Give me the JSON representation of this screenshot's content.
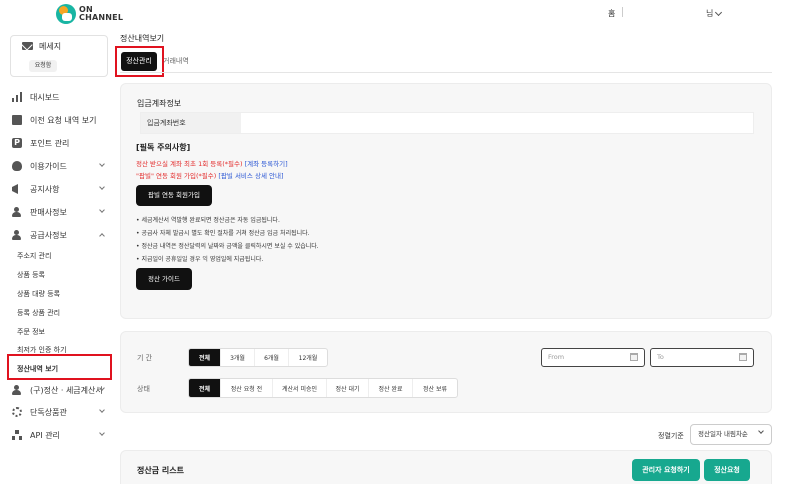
{
  "header": {
    "logo_line1": "ON",
    "logo_line2": "CHANNEL",
    "home": "홈",
    "user": "님"
  },
  "sidebar": {
    "message_label": "메세지",
    "message_pill": "요청함",
    "items": [
      {
        "label": "대시보드"
      },
      {
        "label": "이전 요청 내역 보기"
      },
      {
        "label": "포인트 관리"
      },
      {
        "label": "이용가이드"
      },
      {
        "label": "공지사항"
      },
      {
        "label": "판매사정보"
      },
      {
        "label": "공급사정보"
      }
    ],
    "subitems": [
      {
        "label": "주소지 관리"
      },
      {
        "label": "상품 등록"
      },
      {
        "label": "상품 대량 등록"
      },
      {
        "label": "등록 상품 관리"
      },
      {
        "label": "주문 정보"
      },
      {
        "label": "최저가 인증 하기"
      },
      {
        "label": "정산내역 보기"
      }
    ],
    "items_after": [
      {
        "label": "(구)정산 · 세금계산서"
      },
      {
        "label": "단독상품관"
      },
      {
        "label": "API 관리"
      }
    ]
  },
  "main": {
    "page_title": "정산내역보기",
    "tabs": [
      {
        "label": "정산관리",
        "active": true
      },
      {
        "label": "거래내역",
        "active": false
      }
    ],
    "deposit": {
      "title": "입금계좌정보",
      "account_label": "입금계좌번호",
      "account_value": ""
    },
    "notice": {
      "title": "[필독 주의사항]",
      "line1_red": "정산 받으실 계좌 최초 1회 등록(*필수)",
      "line1_blue": "[계좌 등록하기]",
      "line2_red": "\"팝빌\" 연동 회원 가입(*필수)",
      "line2_blue": "[팝빌 서비스 상세 안내]",
      "popbill_button": "팝빌 연동 회원가입",
      "bullets": [
        "• 세금계산서 역발행 완료되면 정산금은 자동 입금됩니다.",
        "• 공급사 자체 발급시 별도 확인 절차를 거쳐 정산금 입금 처리됩니다.",
        "• 정산금 내역은 정산달력의 날짜와 금액을 클릭하시면 보실 수 있습니다.",
        "• 지급일이 공휴일일 경우 익 영업일에 지급됩니다."
      ],
      "guide_button": "정산 가이드"
    },
    "filter": {
      "period_label": "기 간",
      "period_options": [
        "전체",
        "3개월",
        "6개월",
        "12개월"
      ],
      "period_selected": "전체",
      "from_placeholder": "From",
      "to_placeholder": "To",
      "status_label": "상태",
      "status_options": [
        "전체",
        "정산 요청 전",
        "계산서 미승인",
        "정산 대기",
        "정산 완료",
        "정산 보류"
      ],
      "status_selected": "전체"
    },
    "sort": {
      "label": "정렬기준",
      "value": "정산일자 내림차순"
    },
    "list": {
      "title": "정산금 리스트",
      "admin_request_button": "관리자 요청하기",
      "settle_request_button": "정산요청"
    }
  }
}
